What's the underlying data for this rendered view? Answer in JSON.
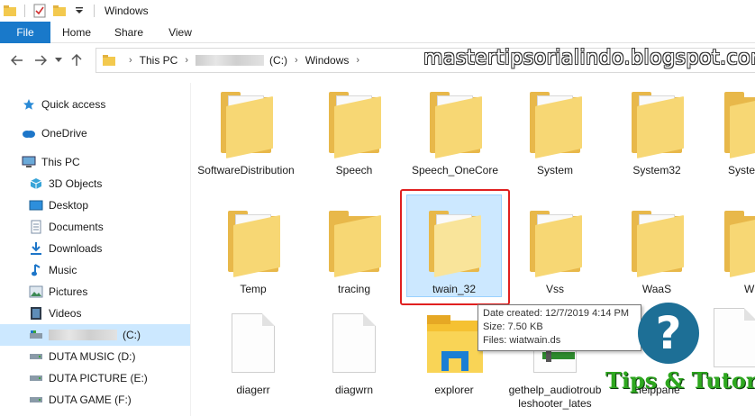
{
  "window": {
    "title": "Windows"
  },
  "ribbon": {
    "file": "File",
    "tabs": [
      "Home",
      "Share",
      "View"
    ]
  },
  "address": {
    "crumbs": [
      "This PC",
      "(C:)",
      "Windows"
    ]
  },
  "watermark": "mastertipsorialindo.blogspot.com",
  "sidebar": {
    "items": [
      {
        "label": "Quick access",
        "icon": "star-icon"
      },
      {
        "label": "OneDrive",
        "icon": "cloud-icon"
      },
      {
        "label": "This PC",
        "icon": "computer-icon"
      },
      {
        "label": "3D Objects",
        "icon": "cube-icon"
      },
      {
        "label": "Desktop",
        "icon": "desktop-icon"
      },
      {
        "label": "Documents",
        "icon": "documents-icon"
      },
      {
        "label": "Downloads",
        "icon": "download-icon"
      },
      {
        "label": "Music",
        "icon": "music-icon"
      },
      {
        "label": "Pictures",
        "icon": "pictures-icon"
      },
      {
        "label": "Videos",
        "icon": "videos-icon"
      },
      {
        "label": "(C:)",
        "icon": "drive-icon"
      },
      {
        "label": "DUTA MUSIC (D:)",
        "icon": "drive-icon"
      },
      {
        "label": "DUTA PICTURE (E:)",
        "icon": "drive-icon"
      },
      {
        "label": "DUTA GAME (F:)",
        "icon": "drive-icon"
      }
    ]
  },
  "files": {
    "row1": [
      "SoftwareDistribution",
      "Speech",
      "Speech_OneCore",
      "System",
      "System32",
      "Syste"
    ],
    "row2": [
      "Temp",
      "tracing",
      "twain_32",
      "Vss",
      "WaaS",
      "W"
    ],
    "row3": [
      "diagerr",
      "diagwrn",
      "explorer",
      "gethelp_audiotroubleshooter_lates",
      "Helppane"
    ]
  },
  "tooltip": {
    "line1": "Date created: 12/7/2019 4:14 PM",
    "line2": "Size: 7.50 KB",
    "line3": "Files: wiatwain.ds"
  },
  "logo": {
    "symbol": "?",
    "text": "Tips & Tutorial"
  },
  "colors": {
    "accent": "#1979ca",
    "selection": "#cce8ff",
    "highlight_border": "#e02020",
    "folder": "#f7d774"
  }
}
